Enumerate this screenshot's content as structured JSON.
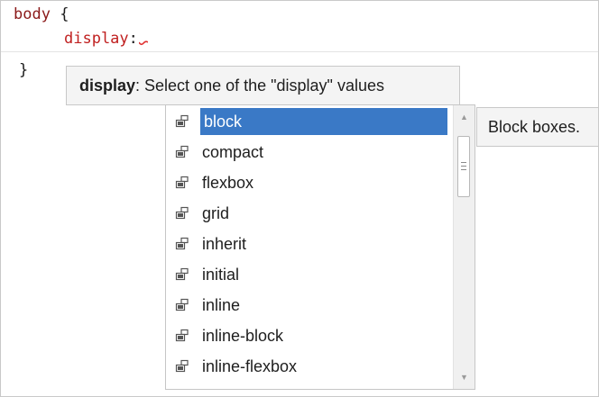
{
  "editor": {
    "line1_selector": "body",
    "line1_brace": " {",
    "line2_property": "display",
    "line2_colon": ":",
    "line3_brace": "}"
  },
  "parameter_tooltip": {
    "property": "display",
    "description": ": Select one of the \"display\" values"
  },
  "completion_list": {
    "items": [
      {
        "label": "block",
        "icon": "property-value-icon",
        "selected": true
      },
      {
        "label": "compact",
        "icon": "property-value-icon"
      },
      {
        "label": "flexbox",
        "icon": "property-value-icon"
      },
      {
        "label": "grid",
        "icon": "property-value-icon"
      },
      {
        "label": "inherit",
        "icon": "property-value-icon"
      },
      {
        "label": "initial",
        "icon": "property-value-icon"
      },
      {
        "label": "inline",
        "icon": "property-value-icon"
      },
      {
        "label": "inline-block",
        "icon": "property-value-icon"
      },
      {
        "label": "inline-flexbox",
        "icon": "property-value-icon"
      }
    ]
  },
  "description_tooltip": {
    "text": "Block boxes."
  },
  "colors": {
    "selector": "#8b1a1a",
    "property": "#c02020",
    "selection": "#3a79c6",
    "error_squiggle": "#e03030"
  }
}
